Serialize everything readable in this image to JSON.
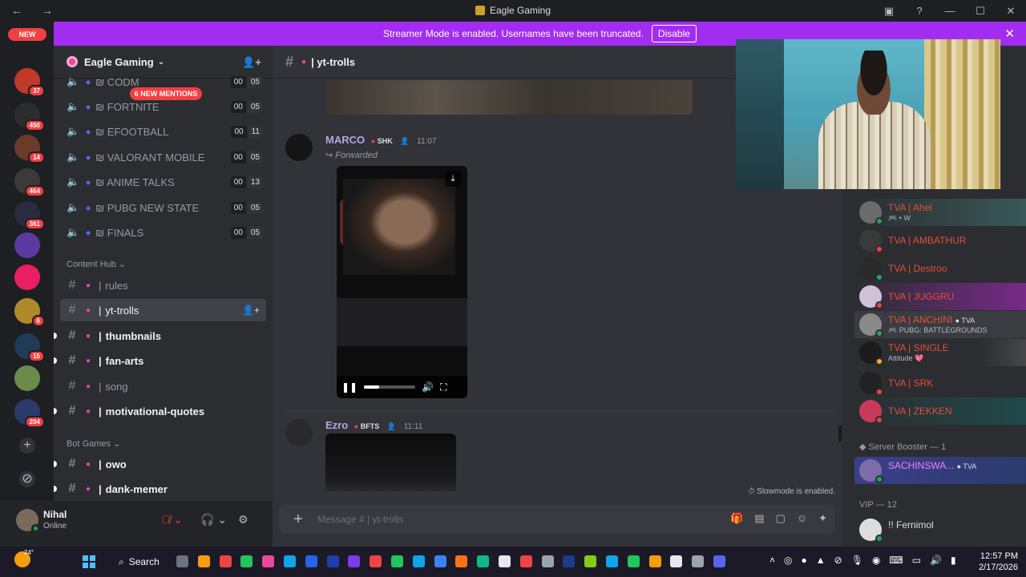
{
  "window": {
    "title": "Eagle Gaming",
    "nav_arrows": "← →"
  },
  "banner": {
    "text": "Streamer Mode is enabled. Usernames have been truncated.",
    "button": "Disable"
  },
  "rail": {
    "new_label": "NEW",
    "servers": [
      {
        "name": "NGRP",
        "badge": "37",
        "color": "#c0392b"
      },
      {
        "name": "server-2",
        "badge": "450",
        "color": "#2c2c2c"
      },
      {
        "name": "server-3",
        "badge": "14",
        "color": "#6b3a2a"
      },
      {
        "name": "server-4",
        "badge": "464",
        "color": "#3a3a3a"
      },
      {
        "name": "server-5",
        "badge": "361",
        "color": "#2a2a40"
      },
      {
        "name": "server-6",
        "badge": "",
        "color": "#5b3aa0"
      },
      {
        "name": "server-7",
        "badge": "",
        "color": "#e91e63"
      },
      {
        "name": "Eagle Gaming",
        "badge": "6",
        "color": "#b08a2a"
      },
      {
        "name": "server-9",
        "badge": "15",
        "color": "#1f3b57"
      },
      {
        "name": "server-10",
        "badge": "",
        "color": "#6c8a4a"
      },
      {
        "name": "server-11",
        "badge": "204",
        "color": "#2a3a6a"
      }
    ]
  },
  "guild": {
    "name": "Eagle Gaming",
    "mentions_badge": "6 NEW MENTIONS",
    "voice_channels": [
      {
        "name": "₪ CODM",
        "users": "00",
        "limit": "05"
      },
      {
        "name": "₪ FORTNITE",
        "users": "00",
        "limit": "05"
      },
      {
        "name": "₪ EFOOTBALL",
        "users": "00",
        "limit": "11"
      },
      {
        "name": "₪ VALORANT MOBILE",
        "users": "00",
        "limit": "05"
      },
      {
        "name": "₪ ANIME TALKS",
        "users": "00",
        "limit": "13"
      },
      {
        "name": "₪ PUBG NEW STATE",
        "users": "00",
        "limit": "05"
      },
      {
        "name": "₪ FINALS",
        "users": "00",
        "limit": "05"
      }
    ],
    "category_content": "Content Hub",
    "content_channels": [
      {
        "name": "rules",
        "state": "normal"
      },
      {
        "name": "yt-trolls",
        "state": "selected"
      },
      {
        "name": "thumbnails",
        "state": "unread"
      },
      {
        "name": "fan-arts",
        "state": "unread"
      },
      {
        "name": "song",
        "state": "normal"
      },
      {
        "name": "motivational-quotes",
        "state": "unread"
      }
    ],
    "category_bots": "Bot Games",
    "bot_channels": [
      {
        "name": "owo",
        "state": "unread"
      },
      {
        "name": "dank-memer",
        "state": "unread"
      }
    ]
  },
  "user": {
    "name": "Nihal",
    "status": "Online"
  },
  "chat": {
    "channel": "yt-trolls",
    "messages": [
      {
        "author": "MARCO",
        "tag": "SHK",
        "time": "11:07",
        "forwarded": "Forwarded",
        "name_color": "#b7a3e8",
        "video_progress": 0.3
      },
      {
        "author": "Ezro",
        "tag": "BFTS",
        "time": "11:11",
        "name_color": "#b7a3e8"
      }
    ],
    "slowmode": "Slowmode is enabled.",
    "composer_placeholder": "Message #  | yt-trolls"
  },
  "members": {
    "rows": [
      {
        "name": "TVA | Ahel",
        "sub": "🎮 • W",
        "status": "online"
      },
      {
        "name": "TVA | AMBATHUR",
        "sub": "",
        "status": "dnd"
      },
      {
        "name": "TVA | Destroo",
        "sub": "",
        "status": "online"
      },
      {
        "name": "TVA | JUGGRU",
        "sub": "",
        "status": "dnd"
      },
      {
        "name": "TVA | ANCHINI",
        "tag": "TVA",
        "sub": "🎮 PUBG: BATTLEGROUNDS",
        "status": "online"
      },
      {
        "name": "TVA | SINGLE",
        "sub": "Attitude 💖",
        "status": "idle"
      },
      {
        "name": "TVA | SRK",
        "sub": "",
        "status": "dnd"
      },
      {
        "name": "TVA | ZEKKEN",
        "sub": "",
        "status": "dnd"
      }
    ],
    "booster_group": "Server Booster — 1",
    "booster": {
      "name": "SACHINSWA...",
      "tag": "TVA"
    },
    "vip_group": "VIP — 12",
    "vip": {
      "name": "!! Fernimol"
    }
  },
  "taskbar": {
    "temp": "24°",
    "search_label": "Search",
    "time": "12:57 PM",
    "date": "2/17/2026"
  },
  "colors": {
    "accent": "#5865f2",
    "banner": "#a22df0",
    "member_name": "#e74c3c"
  }
}
